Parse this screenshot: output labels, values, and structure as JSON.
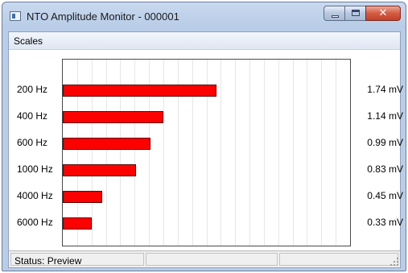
{
  "window": {
    "title": "NTO Amplitude Monitor - 000001"
  },
  "menu": {
    "items": [
      "Scales"
    ]
  },
  "status": {
    "text": "Status: Preview"
  },
  "chart_data": {
    "type": "bar",
    "orientation": "horizontal",
    "categories": [
      "200 Hz",
      "400 Hz",
      "600 Hz",
      "1000 Hz",
      "4000 Hz",
      "6000 Hz"
    ],
    "values": [
      1.74,
      1.14,
      0.99,
      0.83,
      0.45,
      0.33
    ],
    "value_labels": [
      "1.74 mV",
      "1.14 mV",
      "0.99 mV",
      "0.83 mV",
      "0.45 mV",
      "0.33 mV"
    ],
    "unit": "mV",
    "xlim": [
      0,
      3.25
    ],
    "grid": true,
    "bar_color": "#ff0000"
  }
}
